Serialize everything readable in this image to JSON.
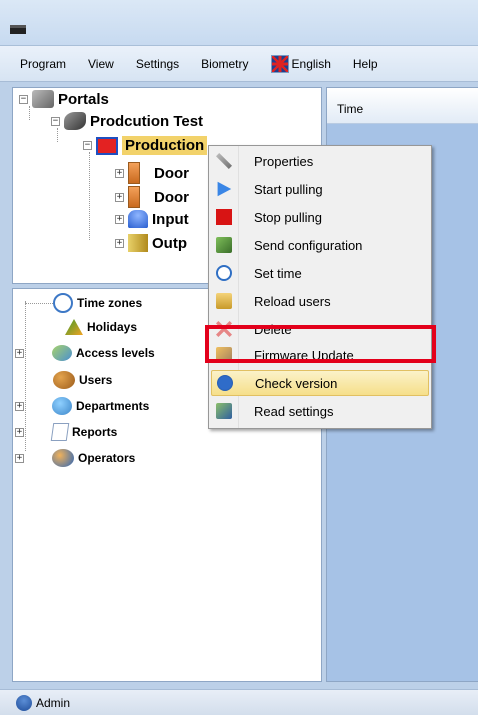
{
  "menu": {
    "items": [
      "Program",
      "View",
      "Settings",
      "Biometry",
      "English",
      "Help"
    ]
  },
  "tree_top": {
    "portals": "Portals",
    "site": "Prodcution Test",
    "device": "Production",
    "door1": "Door",
    "door2": "Door",
    "inputs": "Input",
    "outputs": "Outp"
  },
  "tree_bottom": {
    "items": [
      "Time zones",
      "Holidays",
      "Access levels",
      "Users",
      "Departments",
      "Reports",
      "Operators"
    ]
  },
  "right_panel": {
    "column_header": "Time"
  },
  "context_menu": {
    "items": [
      {
        "label": "Properties",
        "icon": "tools-icon"
      },
      {
        "label": "Start pulling",
        "icon": "play-icon"
      },
      {
        "label": "Stop pulling",
        "icon": "stop-icon"
      },
      {
        "label": "Send configuration",
        "icon": "send-config-icon"
      },
      {
        "label": "Set time",
        "icon": "clock-icon"
      },
      {
        "label": "Reload users",
        "icon": "reload-users-icon"
      },
      {
        "label": "Delete",
        "icon": "delete-icon"
      },
      {
        "label": "Firmware Update",
        "icon": "firmware-icon"
      },
      {
        "label": "Check version",
        "icon": "info-icon"
      },
      {
        "label": "Read settings",
        "icon": "read-settings-icon"
      }
    ],
    "highlighted_index": 8
  },
  "status": {
    "user": "Admin"
  },
  "colors": {
    "highlight_box": "#e3001b",
    "selection": "#f2d26a"
  }
}
